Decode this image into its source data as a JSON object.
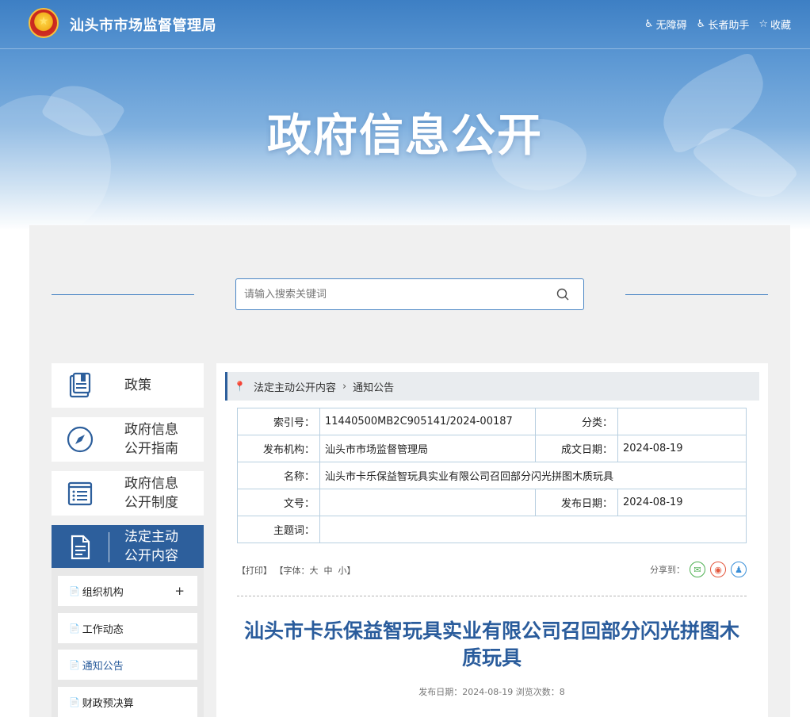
{
  "header": {
    "site_title": "汕头市市场监督管理局",
    "tools": [
      {
        "label": "无障碍",
        "icon": "accessibility-icon"
      },
      {
        "label": "长者助手",
        "icon": "elder-assist-icon"
      },
      {
        "label": "收藏",
        "icon": "star-icon"
      }
    ],
    "banner_title": "政府信息公开"
  },
  "search": {
    "placeholder": "请输入搜索关键词"
  },
  "sidebar": {
    "items": [
      {
        "label": "政策",
        "icon": "book-icon"
      },
      {
        "label": "政府信息\n公开指南",
        "icon": "compass-icon"
      },
      {
        "label": "政府信息\n公开制度",
        "icon": "list-icon"
      },
      {
        "label": "法定主动\n公开内容",
        "icon": "document-icon"
      }
    ],
    "subitems": [
      {
        "label": "组织机构",
        "plus": "+"
      },
      {
        "label": "工作动态"
      },
      {
        "label": "通知公告"
      },
      {
        "label": "财政预决算"
      }
    ]
  },
  "breadcrumb": {
    "parent": "法定主动公开内容",
    "current": "通知公告"
  },
  "meta": {
    "index_label": "索引号：",
    "index_value": "11440500MB2C905141/2024-00187",
    "category_label": "分类：",
    "category_value": "",
    "publisher_label": "发布机构：",
    "publisher_value": "汕头市市场监督管理局",
    "created_label": "成文日期：",
    "created_value": "2024-08-19",
    "name_label": "名称：",
    "name_value": "汕头市卡乐保益智玩具实业有限公司召回部分闪光拼图木质玩具",
    "docno_label": "文号：",
    "docno_value": "",
    "pubdate_label": "发布日期：",
    "pubdate_value": "2024-08-19",
    "subject_label": "主题词：",
    "subject_value": ""
  },
  "options": {
    "print": "【打印】",
    "font_prefix": "【字体：",
    "font_large": "大",
    "font_medium": "中",
    "font_small": "小",
    "font_suffix": "】",
    "share_label": "分享到："
  },
  "article": {
    "title": "汕头市卡乐保益智玩具实业有限公司召回部分闪光拼图木质玩具",
    "meta_line": "发布日期：2024-08-19  浏览次数：8"
  },
  "colors": {
    "primary": "#2d5f9c",
    "title_blue": "#2a5c9c",
    "border": "#b8cfe0"
  }
}
